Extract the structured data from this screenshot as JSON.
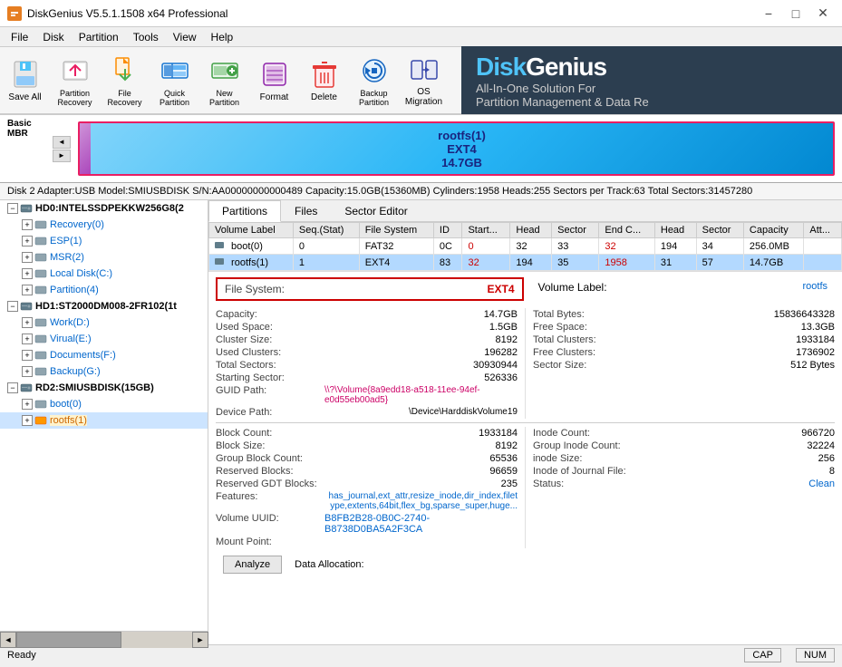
{
  "titleBar": {
    "title": "DiskGenius V5.5.1.1508 x64 Professional",
    "icon": "DG",
    "controls": [
      "minimize",
      "maximize",
      "close"
    ]
  },
  "menuBar": {
    "items": [
      "File",
      "Disk",
      "Partition",
      "Tools",
      "View",
      "Help"
    ]
  },
  "toolbar": {
    "buttons": [
      {
        "label": "Save All",
        "icon": "save"
      },
      {
        "label": "Partition\nRecovery",
        "icon": "recovery"
      },
      {
        "label": "File\nRecovery",
        "icon": "file-recovery"
      },
      {
        "label": "Quick\nPartition",
        "icon": "quick"
      },
      {
        "label": "New\nPartition",
        "icon": "new-part"
      },
      {
        "label": "Format",
        "icon": "format"
      },
      {
        "label": "Delete",
        "icon": "delete"
      },
      {
        "label": "Backup\nPartition",
        "icon": "backup"
      },
      {
        "label": "OS Migration",
        "icon": "os-mig"
      }
    ],
    "brand": {
      "name": "DiskGenius",
      "tagline": "All-In-One Solution For",
      "subtitle": "Partition Management & Data Re"
    }
  },
  "diskBar": {
    "label1": "Basic",
    "label2": "MBR",
    "partitionName": "rootfs(1)",
    "partitionFS": "EXT4",
    "partitionSize": "14.7GB"
  },
  "diskInfo": "Disk 2  Adapter:USB  Model:SMIUSBDISK  S/N:AA00000000000489  Capacity:15.0GB(15360MB)  Cylinders:1958  Heads:255  Sectors per Track:63  Total Sectors:31457280",
  "tree": {
    "items": [
      {
        "id": "hd0",
        "label": "HD0:INTELSSDPEKKW256G8(2",
        "type": "disk",
        "indent": 0,
        "expanded": true
      },
      {
        "id": "recovery",
        "label": "Recovery(0)",
        "type": "partition",
        "indent": 1,
        "expanded": false
      },
      {
        "id": "esp",
        "label": "ESP(1)",
        "type": "partition",
        "indent": 1
      },
      {
        "id": "msr",
        "label": "MSR(2)",
        "type": "partition",
        "indent": 1
      },
      {
        "id": "local-c",
        "label": "Local Disk(C:)",
        "type": "partition",
        "indent": 1
      },
      {
        "id": "partition4",
        "label": "Partition(4)",
        "type": "partition",
        "indent": 1
      },
      {
        "id": "hd1",
        "label": "HD1:ST2000DM008-2FR102(1t",
        "type": "disk",
        "indent": 0,
        "expanded": true
      },
      {
        "id": "work-d",
        "label": "Work(D:)",
        "type": "partition",
        "indent": 1
      },
      {
        "id": "virual-e",
        "label": "Virual(E:)",
        "type": "partition",
        "indent": 1
      },
      {
        "id": "documents-f",
        "label": "Documents(F:)",
        "type": "partition",
        "indent": 1
      },
      {
        "id": "backup-g",
        "label": "Backup(G:)",
        "type": "partition",
        "indent": 1
      },
      {
        "id": "rd2",
        "label": "RD2:SMIUSBDISK(15GB)",
        "type": "disk",
        "indent": 0,
        "expanded": true,
        "selected": false
      },
      {
        "id": "boot0",
        "label": "boot(0)",
        "type": "partition",
        "indent": 1
      },
      {
        "id": "rootfs1",
        "label": "rootfs(1)",
        "type": "partition-highlighted",
        "indent": 1,
        "selected": true
      }
    ]
  },
  "tabs": [
    "Partitions",
    "Files",
    "Sector Editor"
  ],
  "activeTab": 0,
  "partitionsTable": {
    "columns": [
      "Volume Label",
      "Seq.(Stat)",
      "File System",
      "ID",
      "Start...",
      "Head",
      "Sector",
      "End C...",
      "Head",
      "Sector",
      "Capacity",
      "Att..."
    ],
    "rows": [
      {
        "icon": "hdd",
        "volumeLabel": "boot(0)",
        "seq": "0",
        "fileSystem": "FAT32",
        "id": "0C",
        "startCyl": "0",
        "startHead": "32",
        "startSector": "33",
        "endCyl": "32",
        "endHead": "194",
        "endSector": "34",
        "capacity": "256.0MB",
        "attr": "",
        "selected": false,
        "redCols": [
          "startCyl",
          "endCyl"
        ]
      },
      {
        "icon": "hdd",
        "volumeLabel": "rootfs(1)",
        "seq": "1",
        "fileSystem": "EXT4",
        "id": "83",
        "startCyl": "32",
        "startHead": "194",
        "startSector": "35",
        "endCyl": "1958",
        "endHead": "31",
        "endSector": "57",
        "capacity": "14.7GB",
        "attr": "",
        "selected": true,
        "redCols": [
          "startCyl",
          "endCyl"
        ]
      }
    ]
  },
  "fsInfo": {
    "fileSystemLabel": "File System:",
    "fileSystemValue": "EXT4",
    "volumeLabelLabel": "Volume Label:",
    "volumeLabelValue": "rootfs",
    "leftDetails": [
      {
        "label": "Capacity:",
        "value": "14.7GB"
      },
      {
        "label": "Used Space:",
        "value": "1.5GB"
      },
      {
        "label": "Cluster Size:",
        "value": "8192"
      },
      {
        "label": "Used Clusters:",
        "value": "196282"
      },
      {
        "label": "Total Sectors:",
        "value": "30930944"
      },
      {
        "label": "Starting Sector:",
        "value": "526336"
      },
      {
        "label": "GUID Path:",
        "value": "\\\\?\\Volume{8a9edd18-a518-11ee-94ef-e0d55eb00ad5}"
      },
      {
        "label": "Device Path:",
        "value": "\\Device\\HarddiskVolume19"
      }
    ],
    "rightDetails": [
      {
        "label": "Total Bytes:",
        "value": "15836643328"
      },
      {
        "label": "Free Space:",
        "value": "13.3GB"
      },
      {
        "label": "Total Clusters:",
        "value": "1933184"
      },
      {
        "label": "Free Clusters:",
        "value": "1736902"
      },
      {
        "label": "Sector Size:",
        "value": "512 Bytes"
      }
    ],
    "ext4Details": {
      "left": [
        {
          "label": "Block Count:",
          "value": "1933184"
        },
        {
          "label": "Block Size:",
          "value": "8192"
        },
        {
          "label": "Group Block Count:",
          "value": "65536"
        },
        {
          "label": "Reserved Blocks:",
          "value": "96659"
        },
        {
          "label": "Reserved GDT Blocks:",
          "value": "235"
        },
        {
          "label": "Features:",
          "value": "has_journal,ext_attr,resize_inode,dir_index,filetype,extents,64bit,flex_bg,sparse_super,huge..."
        },
        {
          "label": "Volume UUID:",
          "value": "B8FB2B28-0B0C-2740-B8738D0BA5A2F3CA"
        },
        {
          "label": "Mount Point:",
          "value": ""
        }
      ],
      "right": [
        {
          "label": "Inode Count:",
          "value": "966720"
        },
        {
          "label": "Group Inode Count:",
          "value": "32224"
        },
        {
          "label": "inode Size:",
          "value": "256"
        },
        {
          "label": "Inode of Journal File:",
          "value": "8"
        },
        {
          "label": "Status:",
          "value": "Clean"
        }
      ]
    },
    "analyzeBtn": "Analyze",
    "dataAllocation": "Data Allocation:"
  },
  "statusBar": {
    "text": "Ready",
    "indicators": [
      "CAP",
      "NUM"
    ]
  }
}
